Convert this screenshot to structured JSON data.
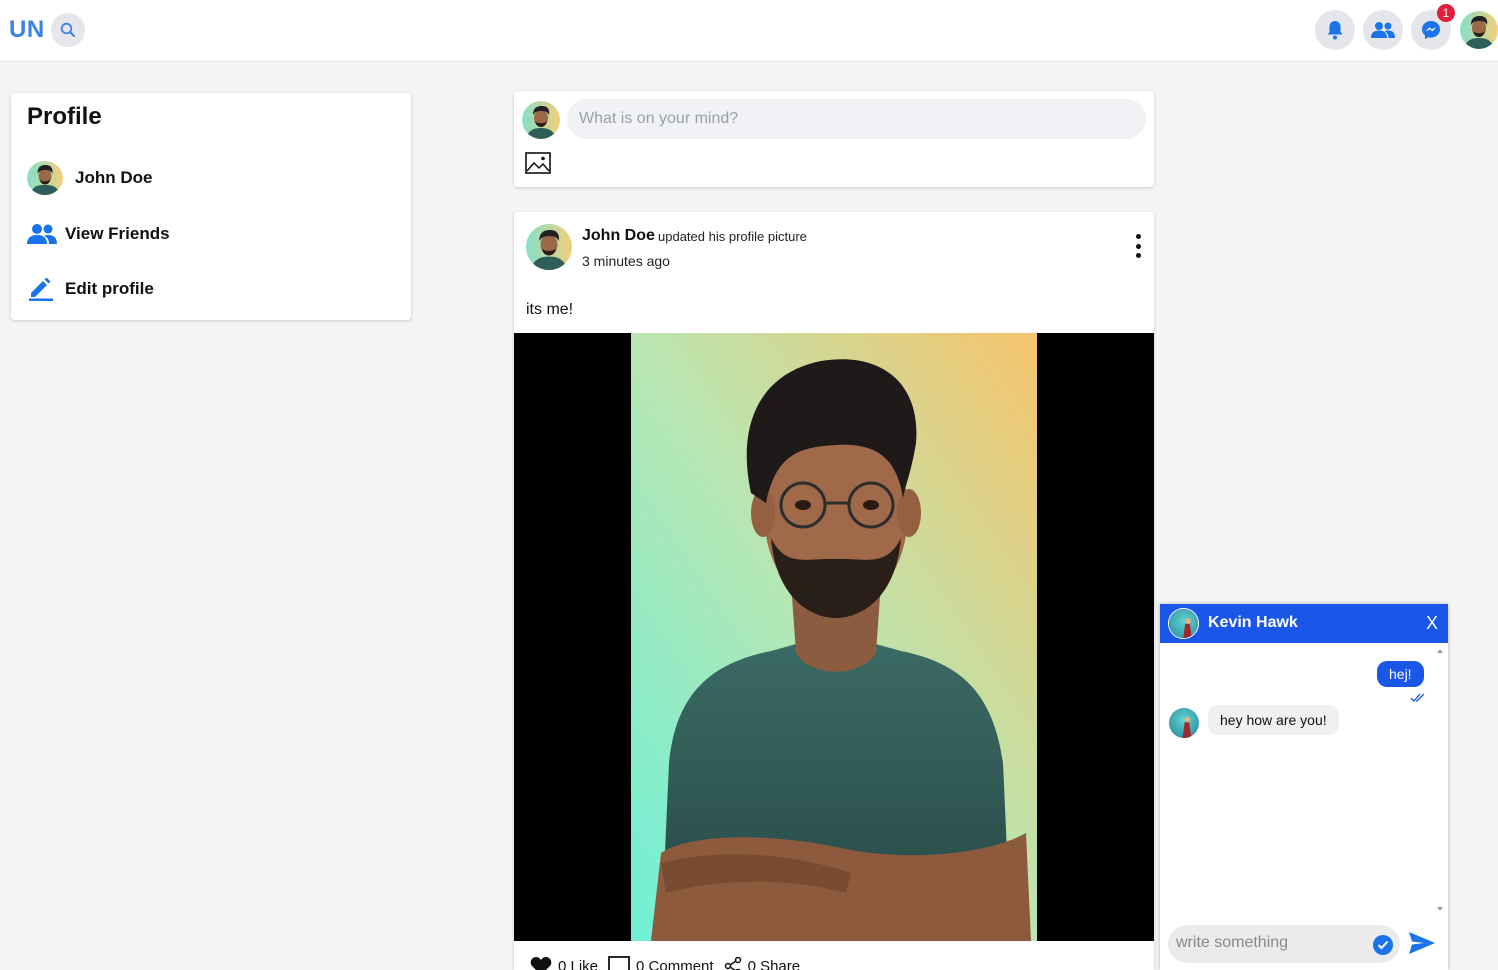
{
  "header": {
    "logo": "UN",
    "messages_badge": "1",
    "icons": [
      "search-icon",
      "bell-icon",
      "friends-icon",
      "messenger-icon"
    ]
  },
  "sidebar": {
    "title": "Profile",
    "items": [
      {
        "label": "John  Doe",
        "icon": "avatar"
      },
      {
        "label": "View  Friends",
        "icon": "friends-icon"
      },
      {
        "label": "Edit  profile",
        "icon": "pencil-icon"
      }
    ]
  },
  "composer": {
    "placeholder": "What is on your mind?"
  },
  "post": {
    "author": "John Doe",
    "action": "updated his profile picture",
    "time": "3 minutes ago",
    "text": "its me!",
    "like_label": "0 Like",
    "comment_label": "0 Comment",
    "share_label": "0 Share"
  },
  "chat": {
    "name": "Kevin  Hawk",
    "close": "X",
    "messages": [
      {
        "from": "me",
        "text": "hej!"
      },
      {
        "from": "them",
        "text": "hey how are you!"
      }
    ],
    "placeholder": "write something"
  },
  "colors": {
    "accent": "#1a56e8",
    "logo": "#3b82e8",
    "badge": "#e41e3f"
  }
}
